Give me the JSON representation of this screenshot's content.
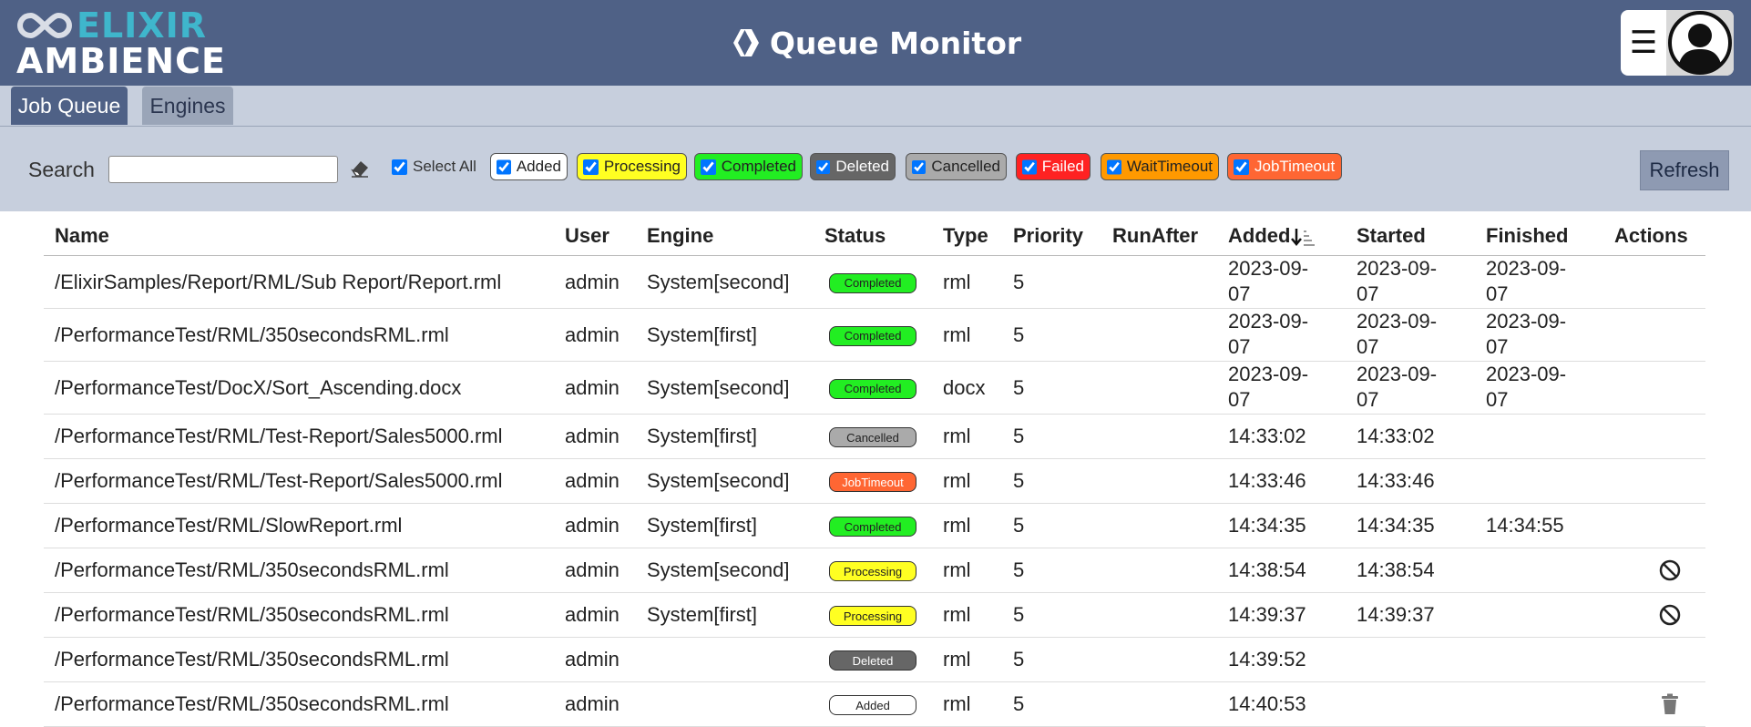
{
  "header": {
    "logo_top": "ELIXIR",
    "logo_bottom": "AMBIENCE",
    "title": "Queue Monitor",
    "menu_icon": "hamburger-icon",
    "avatar_icon": "user-avatar-icon"
  },
  "tabs": [
    {
      "label": "Job Queue",
      "active": true
    },
    {
      "label": "Engines",
      "active": false
    }
  ],
  "filters": {
    "search_label": "Search",
    "search_value": "",
    "select_all": "Select All",
    "refresh": "Refresh",
    "chips": [
      {
        "label": "Added",
        "bg": "#ffffff",
        "fg": "#222222",
        "checked": true
      },
      {
        "label": "Processing",
        "bg": "#ffff22",
        "fg": "#222222",
        "checked": true
      },
      {
        "label": "Completed",
        "bg": "#22ee22",
        "fg": "#222222",
        "checked": true
      },
      {
        "label": "Deleted",
        "bg": "#666666",
        "fg": "#ffffff",
        "checked": true
      },
      {
        "label": "Cancelled",
        "bg": "#aaaaaa",
        "fg": "#222222",
        "checked": true
      },
      {
        "label": "Failed",
        "bg": "#ff2222",
        "fg": "#ffffff",
        "checked": true
      },
      {
        "label": "WaitTimeout",
        "bg": "#ff9900",
        "fg": "#222222",
        "checked": true
      },
      {
        "label": "JobTimeout",
        "bg": "#ff6633",
        "fg": "#ffffff",
        "checked": true
      }
    ]
  },
  "table": {
    "columns": [
      "Name",
      "User",
      "Engine",
      "Status",
      "Type",
      "Priority",
      "RunAfter",
      "Added",
      "Started",
      "Finished",
      "Actions"
    ],
    "sort_icon": "sort-descending-icon",
    "rows": [
      {
        "name": "/ElixirSamples/Report/RML/Sub Report/Report.rml",
        "user": "admin",
        "engine": "System[second]",
        "status": "Completed",
        "type": "rml",
        "priority": "5",
        "runafter": "",
        "added": [
          "2023-09-",
          "07"
        ],
        "started": [
          "2023-09-",
          "07"
        ],
        "finished": [
          "2023-09-",
          "07"
        ],
        "action": ""
      },
      {
        "name": "/PerformanceTest/RML/350secondsRML.rml",
        "user": "admin",
        "engine": "System[first]",
        "status": "Completed",
        "type": "rml",
        "priority": "5",
        "runafter": "",
        "added": [
          "2023-09-",
          "07"
        ],
        "started": [
          "2023-09-",
          "07"
        ],
        "finished": [
          "2023-09-",
          "07"
        ],
        "action": ""
      },
      {
        "name": "/PerformanceTest/DocX/Sort_Ascending.docx",
        "user": "admin",
        "engine": "System[second]",
        "status": "Completed",
        "type": "docx",
        "priority": "5",
        "runafter": "",
        "added": [
          "2023-09-",
          "07"
        ],
        "started": [
          "2023-09-",
          "07"
        ],
        "finished": [
          "2023-09-",
          "07"
        ],
        "action": ""
      },
      {
        "name": "/PerformanceTest/RML/Test-Report/Sales5000.rml",
        "user": "admin",
        "engine": "System[first]",
        "status": "Cancelled",
        "type": "rml",
        "priority": "5",
        "runafter": "",
        "added": [
          "14:33:02"
        ],
        "started": [
          "14:33:02"
        ],
        "finished": [
          ""
        ],
        "action": ""
      },
      {
        "name": "/PerformanceTest/RML/Test-Report/Sales5000.rml",
        "user": "admin",
        "engine": "System[second]",
        "status": "JobTimeout",
        "type": "rml",
        "priority": "5",
        "runafter": "",
        "added": [
          "14:33:46"
        ],
        "started": [
          "14:33:46"
        ],
        "finished": [
          ""
        ],
        "action": ""
      },
      {
        "name": "/PerformanceTest/RML/SlowReport.rml",
        "user": "admin",
        "engine": "System[first]",
        "status": "Completed",
        "type": "rml",
        "priority": "5",
        "runafter": "",
        "added": [
          "14:34:35"
        ],
        "started": [
          "14:34:35"
        ],
        "finished": [
          "14:34:55"
        ],
        "action": ""
      },
      {
        "name": "/PerformanceTest/RML/350secondsRML.rml",
        "user": "admin",
        "engine": "System[second]",
        "status": "Processing",
        "type": "rml",
        "priority": "5",
        "runafter": "",
        "added": [
          "14:38:54"
        ],
        "started": [
          "14:38:54"
        ],
        "finished": [
          ""
        ],
        "action": "cancel-icon"
      },
      {
        "name": "/PerformanceTest/RML/350secondsRML.rml",
        "user": "admin",
        "engine": "System[first]",
        "status": "Processing",
        "type": "rml",
        "priority": "5",
        "runafter": "",
        "added": [
          "14:39:37"
        ],
        "started": [
          "14:39:37"
        ],
        "finished": [
          ""
        ],
        "action": "cancel-icon"
      },
      {
        "name": "/PerformanceTest/RML/350secondsRML.rml",
        "user": "admin",
        "engine": "",
        "status": "Deleted",
        "type": "rml",
        "priority": "5",
        "runafter": "",
        "added": [
          "14:39:52"
        ],
        "started": [
          ""
        ],
        "finished": [
          ""
        ],
        "action": ""
      },
      {
        "name": "/PerformanceTest/RML/350secondsRML.rml",
        "user": "admin",
        "engine": "",
        "status": "Added",
        "type": "rml",
        "priority": "5",
        "runafter": "",
        "added": [
          "14:40:53"
        ],
        "started": [
          ""
        ],
        "finished": [
          ""
        ],
        "action": "trash-icon"
      }
    ]
  },
  "status_colors": {
    "Completed": {
      "bg": "#22ee22",
      "fg": "#222222"
    },
    "Cancelled": {
      "bg": "#aaaaaa",
      "fg": "#222222"
    },
    "JobTimeout": {
      "bg": "#ff6633",
      "fg": "#ffffff"
    },
    "Processing": {
      "bg": "#ffff22",
      "fg": "#222222"
    },
    "Deleted": {
      "bg": "#666666",
      "fg": "#ffffff"
    },
    "Added": {
      "bg": "#ffffff",
      "fg": "#222222"
    }
  }
}
